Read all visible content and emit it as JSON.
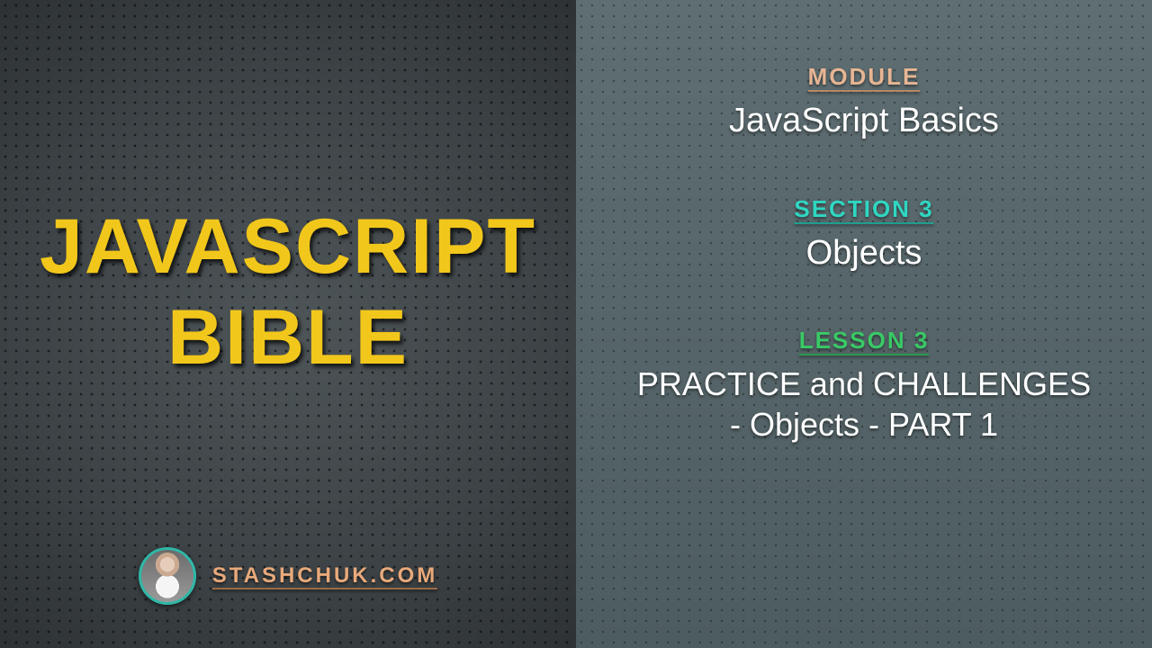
{
  "course": {
    "title_line1": "JAVASCRIPT",
    "title_line2": "BIBLE",
    "author_site": "STASHCHUK.COM"
  },
  "labels": {
    "module": "MODULE",
    "section": "SECTION 3",
    "lesson": "LESSON 3"
  },
  "module": {
    "name": "JavaScript Basics"
  },
  "section": {
    "name": "Objects"
  },
  "lesson": {
    "name": "PRACTICE and CHALLENGES - Objects - PART 1"
  },
  "colors": {
    "accent_yellow": "#f2c71b",
    "accent_peach": "#e8a97b",
    "accent_teal": "#2fd7c2",
    "accent_green": "#39c966"
  }
}
